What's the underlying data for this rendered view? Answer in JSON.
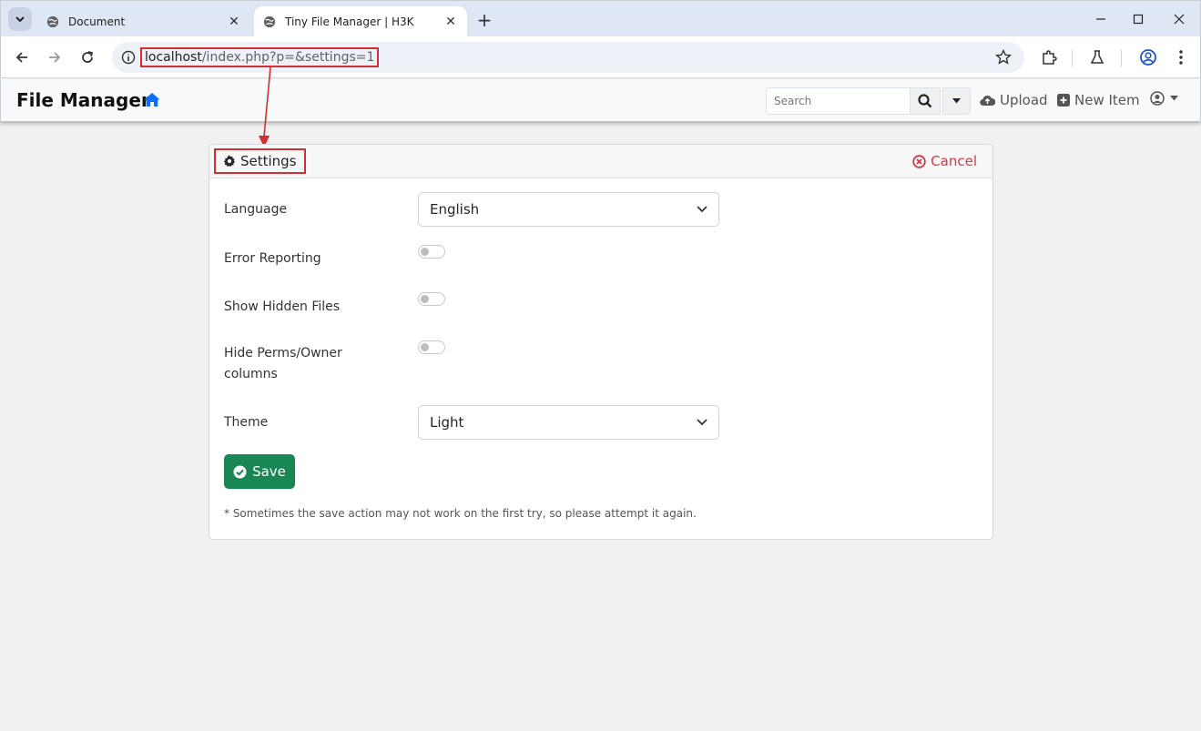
{
  "browser": {
    "tabs": [
      {
        "title": "Document",
        "active": false
      },
      {
        "title": "Tiny File Manager | H3K",
        "active": true
      }
    ],
    "url_host": "localhost",
    "url_path": "/index.php?p=&settings=1"
  },
  "navbar": {
    "brand": "File Manager",
    "search_placeholder": "Search",
    "upload_label": "Upload",
    "new_item_label": "New Item"
  },
  "settings": {
    "title": "Settings",
    "cancel_label": "Cancel",
    "fields": {
      "language_label": "Language",
      "language_value": "English",
      "error_reporting_label": "Error Reporting",
      "show_hidden_label": "Show Hidden Files",
      "hide_perms_label_line1": "Hide Perms/Owner",
      "hide_perms_label_line2": "columns",
      "theme_label": "Theme",
      "theme_value": "Light"
    },
    "toggles": {
      "error_reporting": false,
      "show_hidden": false,
      "hide_perms": false
    },
    "save_label": "Save",
    "note": "* Sometimes the save action may not work on the first try, so please attempt it again."
  },
  "colors": {
    "accent_red": "#dc3545",
    "save_green": "#198754",
    "home_blue": "#0d6efd",
    "annotation_red": "#d32f2f"
  }
}
